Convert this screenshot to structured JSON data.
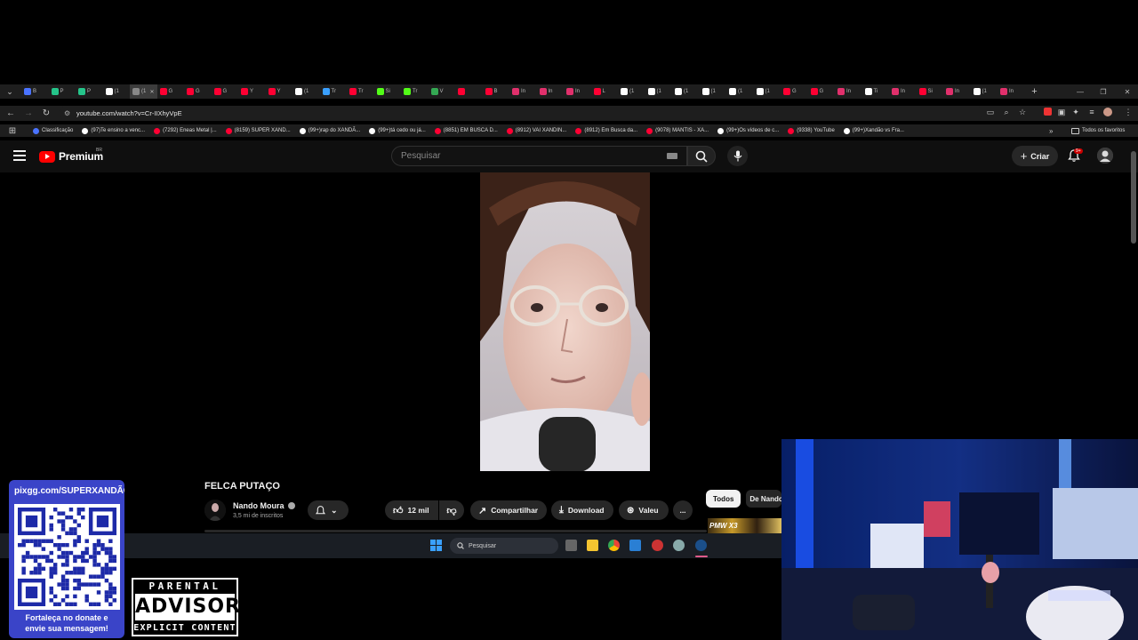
{
  "browser": {
    "tabs": [
      {
        "label": "B",
        "color": "#4a73ff"
      },
      {
        "label": "P",
        "color": "#25c48a"
      },
      {
        "label": "P",
        "color": "#25c48a"
      },
      {
        "label": "(1",
        "color": "#ffffff"
      },
      {
        "label": "(1",
        "color": "#888888",
        "active": true
      },
      {
        "label": "G",
        "color": "#ff0033"
      },
      {
        "label": "G",
        "color": "#ff0033"
      },
      {
        "label": "G",
        "color": "#ff0033"
      },
      {
        "label": "Y",
        "color": "#ff0033"
      },
      {
        "label": "Y",
        "color": "#ff0033"
      },
      {
        "label": "(1",
        "color": "#ffffff"
      },
      {
        "label": "Tr",
        "color": "#3aa0ff"
      },
      {
        "label": "Tr",
        "color": "#ff0033"
      },
      {
        "label": "Si",
        "color": "#53fc18"
      },
      {
        "label": "Tr",
        "color": "#53fc18"
      },
      {
        "label": "V",
        "color": "#34a853"
      },
      {
        "label": "",
        "color": "#ff0033"
      },
      {
        "label": "B",
        "color": "#ff0033"
      },
      {
        "label": "In",
        "color": "#e1306c"
      },
      {
        "label": "In",
        "color": "#e1306c"
      },
      {
        "label": "In",
        "color": "#e1306c"
      },
      {
        "label": "L",
        "color": "#ff0033"
      },
      {
        "label": "(1",
        "color": "#ffffff"
      },
      {
        "label": "(1",
        "color": "#ffffff"
      },
      {
        "label": "(1",
        "color": "#ffffff"
      },
      {
        "label": "(1",
        "color": "#ffffff"
      },
      {
        "label": "(1",
        "color": "#ffffff"
      },
      {
        "label": "(1",
        "color": "#ffffff"
      },
      {
        "label": "G",
        "color": "#ff0033"
      },
      {
        "label": "G",
        "color": "#ff0033"
      },
      {
        "label": "In",
        "color": "#e1306c"
      },
      {
        "label": "Ti",
        "color": "#ffffff"
      },
      {
        "label": "In",
        "color": "#e1306c"
      },
      {
        "label": "Si",
        "color": "#ff0033"
      },
      {
        "label": "In",
        "color": "#e1306c"
      },
      {
        "label": "(1",
        "color": "#ffffff"
      },
      {
        "label": "In",
        "color": "#e1306c"
      }
    ],
    "url": "youtube.com/watch?v=Cr-IIXhyVpE",
    "bookmarks": [
      {
        "label": "Classificação",
        "color": "#4a73ff"
      },
      {
        "label": "(97)Te ensino a venc...",
        "color": "#ffffff"
      },
      {
        "label": "(7292) Eneas Metal |...",
        "color": "#ff0033"
      },
      {
        "label": "(8159) SUPER XAND...",
        "color": "#ff0033"
      },
      {
        "label": "(99+)rap do XANDÃ...",
        "color": "#ffffff"
      },
      {
        "label": "(99+)tá cedo ou já...",
        "color": "#ffffff"
      },
      {
        "label": "(8851) EM BUSCA D...",
        "color": "#ff0033"
      },
      {
        "label": "(8912) VAI XANDIN...",
        "color": "#ff0033"
      },
      {
        "label": "(8912) Em Busca da...",
        "color": "#ff0033"
      },
      {
        "label": "(9078) MANTIS - XA...",
        "color": "#ff0033"
      },
      {
        "label": "(99+)Os vídeos de c...",
        "color": "#ffffff"
      },
      {
        "label": "(9338) YouTube",
        "color": "#ff0033"
      },
      {
        "label": "(99+)Xandão vs Fra...",
        "color": "#ffffff"
      }
    ],
    "all_bookmarks": "Todos os favoritos"
  },
  "youtube": {
    "logo_text": "Premium",
    "country": "BR",
    "search_placeholder": "Pesquisar",
    "create_label": "Criar",
    "notif_badge": "9+"
  },
  "video": {
    "title": "FELCA PUTAÇO",
    "channel": "Nando Moura",
    "subscribers": "3,5 mi de inscritos",
    "likes": "12 mil",
    "share_label": "Compartilhar",
    "download_label": "Download",
    "thanks_label": "Valeu",
    "more_label": "...",
    "chip_all": "Todos",
    "chip_from": "De Nando",
    "thumb_text": "PMW X3"
  },
  "taskbar": {
    "search_label": "Pesquisar"
  },
  "overlay": {
    "donate_url": "pixgg.com/SUPERXANDÃO",
    "donate_line1": "Fortaleça no donate e",
    "donate_line2": "envie sua mensagem!",
    "advisory_top": "PARENTAL",
    "advisory_mid": "ADVISORY",
    "advisory_bot": "EXPLICIT CONTENT"
  }
}
